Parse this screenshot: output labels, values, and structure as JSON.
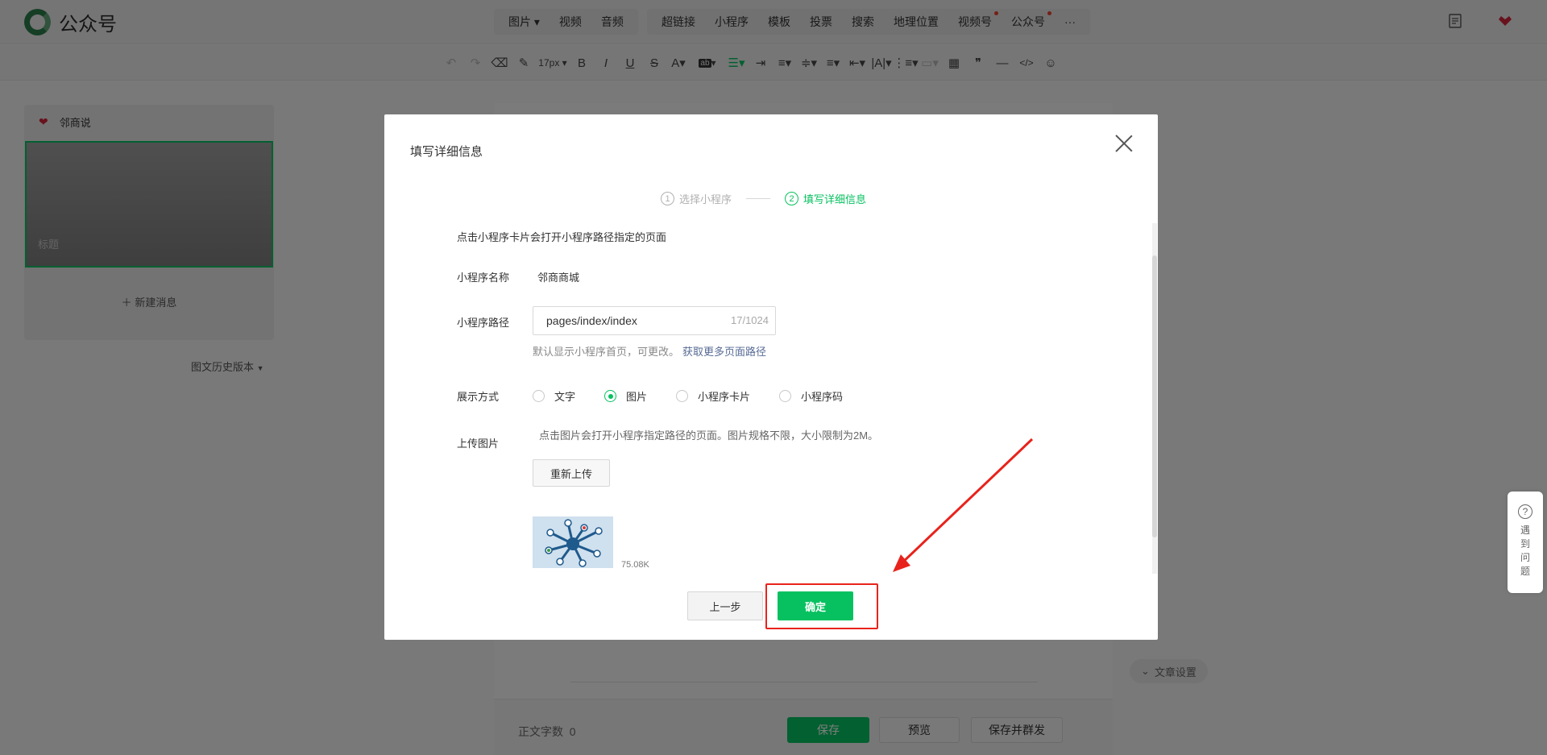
{
  "app": {
    "name": "公众号"
  },
  "insert_menu_left": [
    {
      "label": "图片",
      "has_caret": true
    },
    {
      "label": "视频",
      "has_caret": false
    },
    {
      "label": "音频",
      "has_caret": false
    }
  ],
  "insert_menu_right": [
    {
      "label": "超链接",
      "dot": false
    },
    {
      "label": "小程序",
      "dot": false
    },
    {
      "label": "模板",
      "dot": false
    },
    {
      "label": "投票",
      "dot": false
    },
    {
      "label": "搜索",
      "dot": false
    },
    {
      "label": "地理位置",
      "dot": false
    },
    {
      "label": "视频号",
      "dot": true
    },
    {
      "label": "公众号",
      "dot": true
    },
    {
      "label": "···",
      "dot": false
    }
  ],
  "toolbar": {
    "font_size": "17px",
    "bold": "B",
    "italic": "I",
    "underline": "U",
    "strike": "S",
    "font_color": "A",
    "bg_color": "ab",
    "quote": "❞",
    "code": "</>"
  },
  "sidebar": {
    "account_name": "邻商说",
    "cover_title_placeholder": "标题",
    "new_message": "新建消息",
    "history_label": "图文历史版本"
  },
  "editor": {
    "word_count_label": "正文字数",
    "word_count": "0",
    "save": "保存",
    "preview": "预览",
    "save_publish": "保存并群发",
    "article_settings": "文章设置"
  },
  "help": {
    "label": "遇到问题"
  },
  "dialog": {
    "title": "填写详细信息",
    "steps": [
      {
        "num": "1",
        "label": "选择小程序",
        "active": false
      },
      {
        "num": "2",
        "label": "填写详细信息",
        "active": true
      }
    ],
    "description": "点击小程序卡片会打开小程序路径指定的页面",
    "name_label": "小程序名称",
    "name_value": "邻商商城",
    "path_label": "小程序路径",
    "path_value": "pages/index/index",
    "path_count": "17/1024",
    "path_hint": "默认显示小程序首页，可更改。",
    "path_link": "获取更多页面路径",
    "display_label": "展示方式",
    "display_options": [
      {
        "label": "文字",
        "selected": false
      },
      {
        "label": "图片",
        "selected": true
      },
      {
        "label": "小程序卡片",
        "selected": false
      },
      {
        "label": "小程序码",
        "selected": false
      }
    ],
    "upload_label": "上传图片",
    "upload_hint": "点击图片会打开小程序指定路径的页面。图片规格不限，大小限制为2M。",
    "reupload": "重新上传",
    "file_size": "75.08K",
    "prev": "上一步",
    "confirm": "确定"
  },
  "colors": {
    "accent": "#07c160",
    "link": "#576b95",
    "annotation": "#e8231c"
  }
}
